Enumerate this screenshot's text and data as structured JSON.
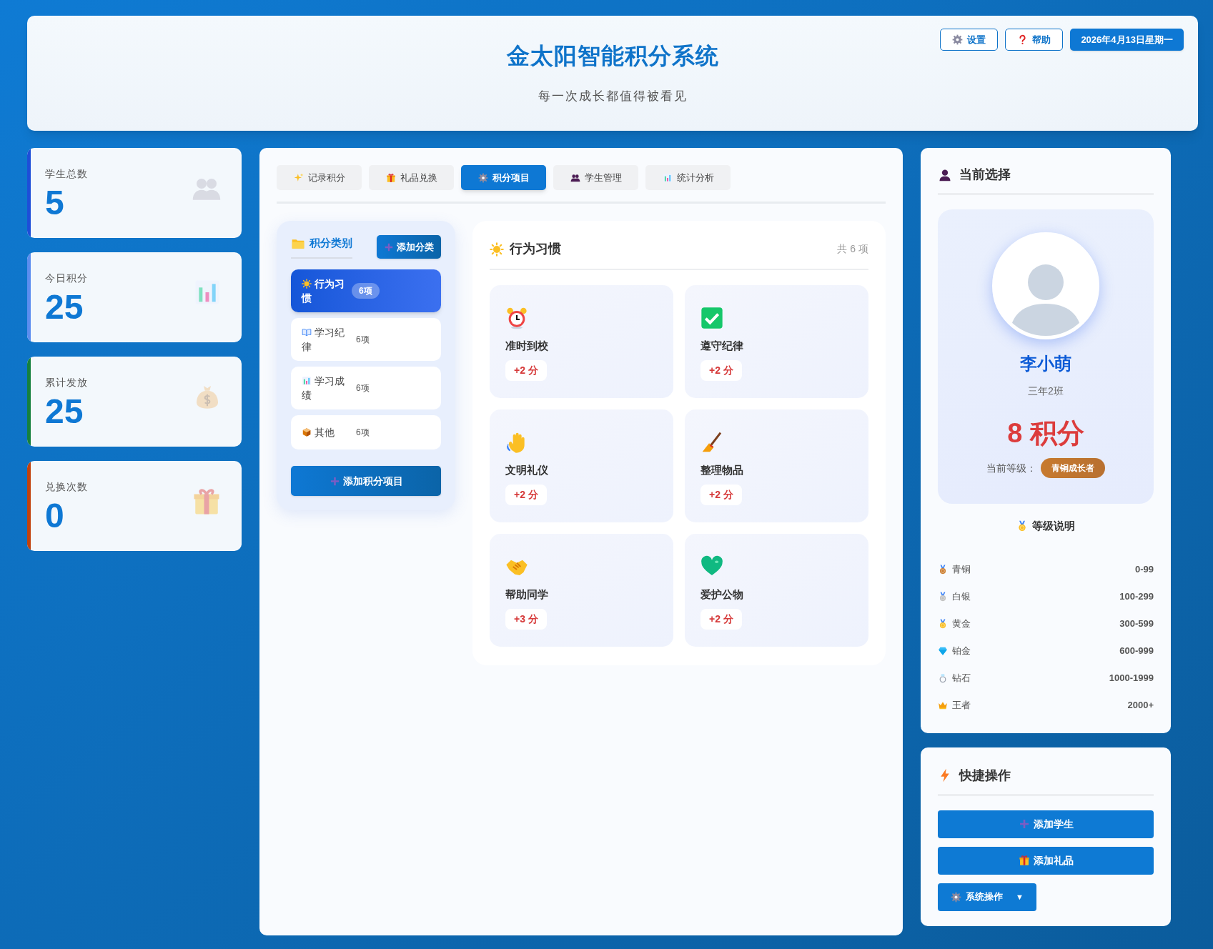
{
  "header": {
    "title": "金太阳智能积分系统",
    "subtitle": "每一次成长都值得被看见",
    "buttons": [
      {
        "label": "设置"
      },
      {
        "label": "帮助"
      }
    ],
    "date": "2026年4月13日星期一"
  },
  "stats": [
    {
      "label": "学生总数",
      "value": "5",
      "color": "#1d4ed8"
    },
    {
      "label": "今日积分",
      "value": "25",
      "color": "#5b8def"
    },
    {
      "label": "累计发放",
      "value": "25",
      "color": "#15803d"
    },
    {
      "label": "兑换次数",
      "value": "0",
      "color": "#c2410c"
    }
  ],
  "tabs": [
    {
      "label": "记录积分",
      "selected": false
    },
    {
      "label": "礼品兑换",
      "selected": false
    },
    {
      "label": "积分项目",
      "selected": true
    },
    {
      "label": "学生管理",
      "selected": false
    },
    {
      "label": "统计分析",
      "selected": false
    }
  ],
  "categories": {
    "title": "积分类别",
    "add_button": "添加分类",
    "items": [
      {
        "label": "行为习惯",
        "count": "6项",
        "selected": true
      },
      {
        "label": "学习纪律",
        "count": "6项",
        "selected": false
      },
      {
        "label": "学习成绩",
        "count": "6项",
        "selected": false
      },
      {
        "label": "其他",
        "count": "6项",
        "selected": false
      }
    ],
    "add_item_button": "添加积分项目"
  },
  "items_panel": {
    "title": "行为习惯",
    "count": "共 6 项",
    "items": [
      {
        "name": "准时到校",
        "points": "+2 分"
      },
      {
        "name": "遵守纪律",
        "points": "+2 分"
      },
      {
        "name": "文明礼仪",
        "points": "+2 分"
      },
      {
        "name": "整理物品",
        "points": "+2 分"
      },
      {
        "name": "帮助同学",
        "points": "+3 分"
      },
      {
        "name": "爱护公物",
        "points": "+2 分"
      }
    ]
  },
  "current": {
    "title": "当前选择",
    "name": "李小萌",
    "class": "三年2班",
    "points": "8 积分",
    "level_label": "当前等级：",
    "level_badge": "青铜成长者",
    "levels_title": "等级说明",
    "levels": [
      {
        "name": "青铜",
        "range": "0-99"
      },
      {
        "name": "白银",
        "range": "100-299"
      },
      {
        "name": "黄金",
        "range": "300-599"
      },
      {
        "name": "铂金",
        "range": "600-999"
      },
      {
        "name": "钻石",
        "range": "1000-1999"
      },
      {
        "name": "王者",
        "range": "2000+"
      }
    ]
  },
  "quick": {
    "title": "快捷操作",
    "buttons": [
      {
        "label": "添加学生"
      },
      {
        "label": "添加礼品"
      }
    ],
    "system_button": {
      "label": "系统操作",
      "caret": "▼"
    }
  }
}
